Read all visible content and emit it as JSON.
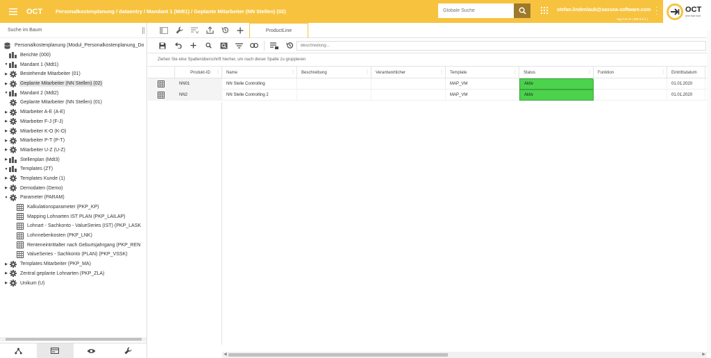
{
  "header": {
    "app_name": "OCT",
    "breadcrumb": "Personalkostenplanung / dataentry / Mandant 1 (Mdt1) / Geplante Mitarbeiter (NN Stellen) (02)",
    "search_placeholder": "Globale Suche",
    "user_email": "stefan.lindenlaub@sassea-software.com",
    "version": "App 5.6.11 | DB 5.5.1 |",
    "logo_main": "OCT",
    "logo_sub": "one tool tool"
  },
  "sidebar": {
    "search_label": "Suche im Baum",
    "tree": [
      {
        "label": "Personalkostenplanung (Modul_Personalkostenplanung_Do",
        "icon": "database-icon",
        "arrow": "",
        "indent": 0
      },
      {
        "label": "Berichte (000)",
        "icon": "building-icon",
        "arrow": "",
        "indent": 1
      },
      {
        "label": "Mandant 1 (Mdt1)",
        "icon": "building-icon",
        "arrow": "down",
        "indent": 1
      },
      {
        "label": "Bestehende Mitarbeiter (01)",
        "icon": "gear-icon",
        "arrow": "right",
        "indent": 2
      },
      {
        "label": "Geplante Mitarbeiter (NN Stellen) (02)",
        "icon": "gear-icon",
        "arrow": "right",
        "indent": 2,
        "selected": true
      },
      {
        "label": "Mandant 2 (Mdt2)",
        "icon": "building-icon",
        "arrow": "down",
        "indent": 1
      },
      {
        "label": "Geplante Mitarbeiter (NN Stellen) (01)",
        "icon": "gear-icon",
        "arrow": "",
        "indent": 2
      },
      {
        "label": "Mitarbeiter A-E (A-E)",
        "icon": "gear-icon",
        "arrow": "right",
        "indent": 2
      },
      {
        "label": "Mitarbeiter F-J (F-J)",
        "icon": "gear-icon",
        "arrow": "right",
        "indent": 2
      },
      {
        "label": "Mitarbeiter K-O (K-O)",
        "icon": "gear-icon",
        "arrow": "right",
        "indent": 2
      },
      {
        "label": "Mitarbeiter P-T (P-T)",
        "icon": "gear-icon",
        "arrow": "right",
        "indent": 2
      },
      {
        "label": "Mitarbeiter U-Z (U-Z)",
        "icon": "gear-icon",
        "arrow": "right",
        "indent": 2
      },
      {
        "label": "Stellenplan (Mdt3)",
        "icon": "building-icon",
        "arrow": "right",
        "indent": 1
      },
      {
        "label": "Templates (ZT)",
        "icon": "building-icon",
        "arrow": "down",
        "indent": 1
      },
      {
        "label": "Templates Kunde (1)",
        "icon": "gear-icon",
        "arrow": "right",
        "indent": 2
      },
      {
        "label": "Demodaten (Demo)",
        "icon": "gear-icon",
        "arrow": "right",
        "indent": 2
      },
      {
        "label": "Parameter (PARAM)",
        "icon": "gear-icon",
        "arrow": "down",
        "indent": 2
      },
      {
        "label": "Kalkulationsparameter (PKP_KP)",
        "icon": "table-icon",
        "arrow": "",
        "indent": 3
      },
      {
        "label": "Mapping Lohnarten IST PLAN (PKP_LAILAP)",
        "icon": "table-icon",
        "arrow": "",
        "indent": 3
      },
      {
        "label": "Lohnart - Sachkonto - ValueSeries (IST) (PKP_LASK",
        "icon": "table-icon",
        "arrow": "",
        "indent": 3
      },
      {
        "label": "Lohnnebenkosten (PKP_LNK)",
        "icon": "table-icon",
        "arrow": "",
        "indent": 3
      },
      {
        "label": "Renteneintrittalter nach Geburtsjahrgang (PKP_REN",
        "icon": "table-icon",
        "arrow": "",
        "indent": 3
      },
      {
        "label": "ValueSeries - Sachkonto (PLAN) (PKP_VSSK)",
        "icon": "table-icon",
        "arrow": "",
        "indent": 3
      },
      {
        "label": "Templates Mitarbeiter (PKP_MA)",
        "icon": "gear-icon",
        "arrow": "right",
        "indent": 2
      },
      {
        "label": "Zentral geplante Lohnarten (PKP_ZLA)",
        "icon": "gear-icon",
        "arrow": "right",
        "indent": 2
      },
      {
        "label": "Unikum (U)",
        "icon": "gear-icon",
        "arrow": "right",
        "indent": 2
      }
    ],
    "bottom_tabs": [
      "hierarchy-icon",
      "card-icon",
      "eye-icon",
      "wrench-icon"
    ]
  },
  "main": {
    "tab_label": "ProductLine",
    "description_placeholder": "Beschreibung...",
    "group_hint": "Ziehen Sie eine Spaltenüberschrift hierher, um nach dieser Spalte zu gruppieren",
    "columns": [
      {
        "label": "",
        "w": 39
      },
      {
        "label": "Produkt-ID",
        "w": 68
      },
      {
        "label": "Name",
        "w": 108
      },
      {
        "label": "Beschreibung",
        "w": 107
      },
      {
        "label": "Verantwortlicher",
        "w": 107
      },
      {
        "label": "Template",
        "w": 106
      },
      {
        "label": "Status",
        "w": 107
      },
      {
        "label": "Funktion",
        "w": 106
      },
      {
        "label": "Eintrittsdatum",
        "w": 55
      }
    ],
    "rows": [
      {
        "id": "NN01",
        "name": "NN Stelle Controlling",
        "beschreibung": "",
        "verantwortlicher": "",
        "template": "MAP_VM",
        "status": "Aktiv",
        "funktion": "",
        "eintritt": "01.01.2020"
      },
      {
        "id": "NN2",
        "name": "NN Stelle Controlling 2",
        "beschreibung": "",
        "verantwortlicher": "",
        "template": "MAP_VM",
        "status": "Aktiv",
        "funktion": "",
        "eintritt": "01.01.2020"
      }
    ]
  },
  "colors": {
    "accent": "#f7c33f",
    "status_active": "#4cd24c"
  }
}
